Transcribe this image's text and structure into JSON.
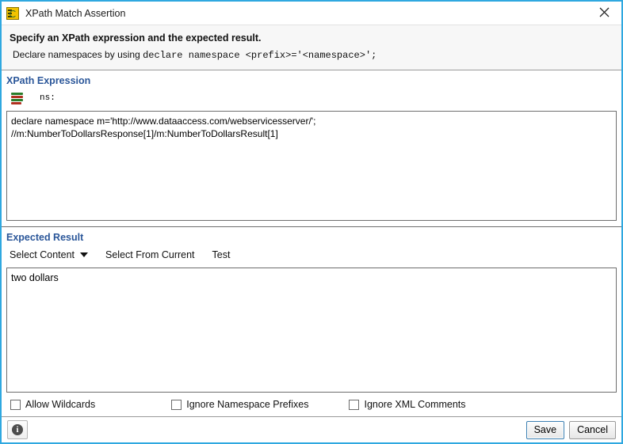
{
  "window": {
    "title": "XPath Match Assertion",
    "icon": "xpath-assertion-icon",
    "close_label": "✕"
  },
  "header": {
    "line1": "Specify an XPath expression and the expected result.",
    "line2_prefix": "Declare namespaces by using ",
    "line2_code": "declare namespace <prefix>='<namespace>';"
  },
  "xpath_section": {
    "title": "XPath Expression",
    "namespace_icon": "namespace-stack-icon",
    "namespace_label": "ns:",
    "expression": "declare namespace m='http://www.dataaccess.com/webservicesserver/';\n//m:NumberToDollarsResponse[1]/m:NumberToDollarsResult[1]",
    "placeholder": ""
  },
  "expected_section": {
    "title": "Expected Result",
    "toolbar": [
      {
        "label": "Select Content",
        "has_caret": true,
        "name": "select-content-dropdown"
      },
      {
        "label": "Select From Current",
        "has_caret": false,
        "name": "select-from-current-button"
      },
      {
        "label": "Test",
        "has_caret": false,
        "name": "test-button"
      }
    ],
    "result_value": "two dollars",
    "placeholder": ""
  },
  "options": [
    {
      "label": "Allow Wildcards",
      "checked": false,
      "name": "allow-wildcards-checkbox"
    },
    {
      "label": "Ignore Namespace Prefixes",
      "checked": false,
      "name": "ignore-namespace-prefixes-checkbox"
    },
    {
      "label": "Ignore XML Comments",
      "checked": false,
      "name": "ignore-xml-comments-checkbox"
    }
  ],
  "footer": {
    "info_icon": "info-icon",
    "info_glyph": "i",
    "save_label": "Save",
    "cancel_label": "Cancel"
  },
  "colors": {
    "dialog_border": "#2fa8e0",
    "section_heading": "#2a5699",
    "header_band": "#f7f7f7",
    "separator": "#6d6d6d",
    "focus_border": "#3c7fb1"
  }
}
